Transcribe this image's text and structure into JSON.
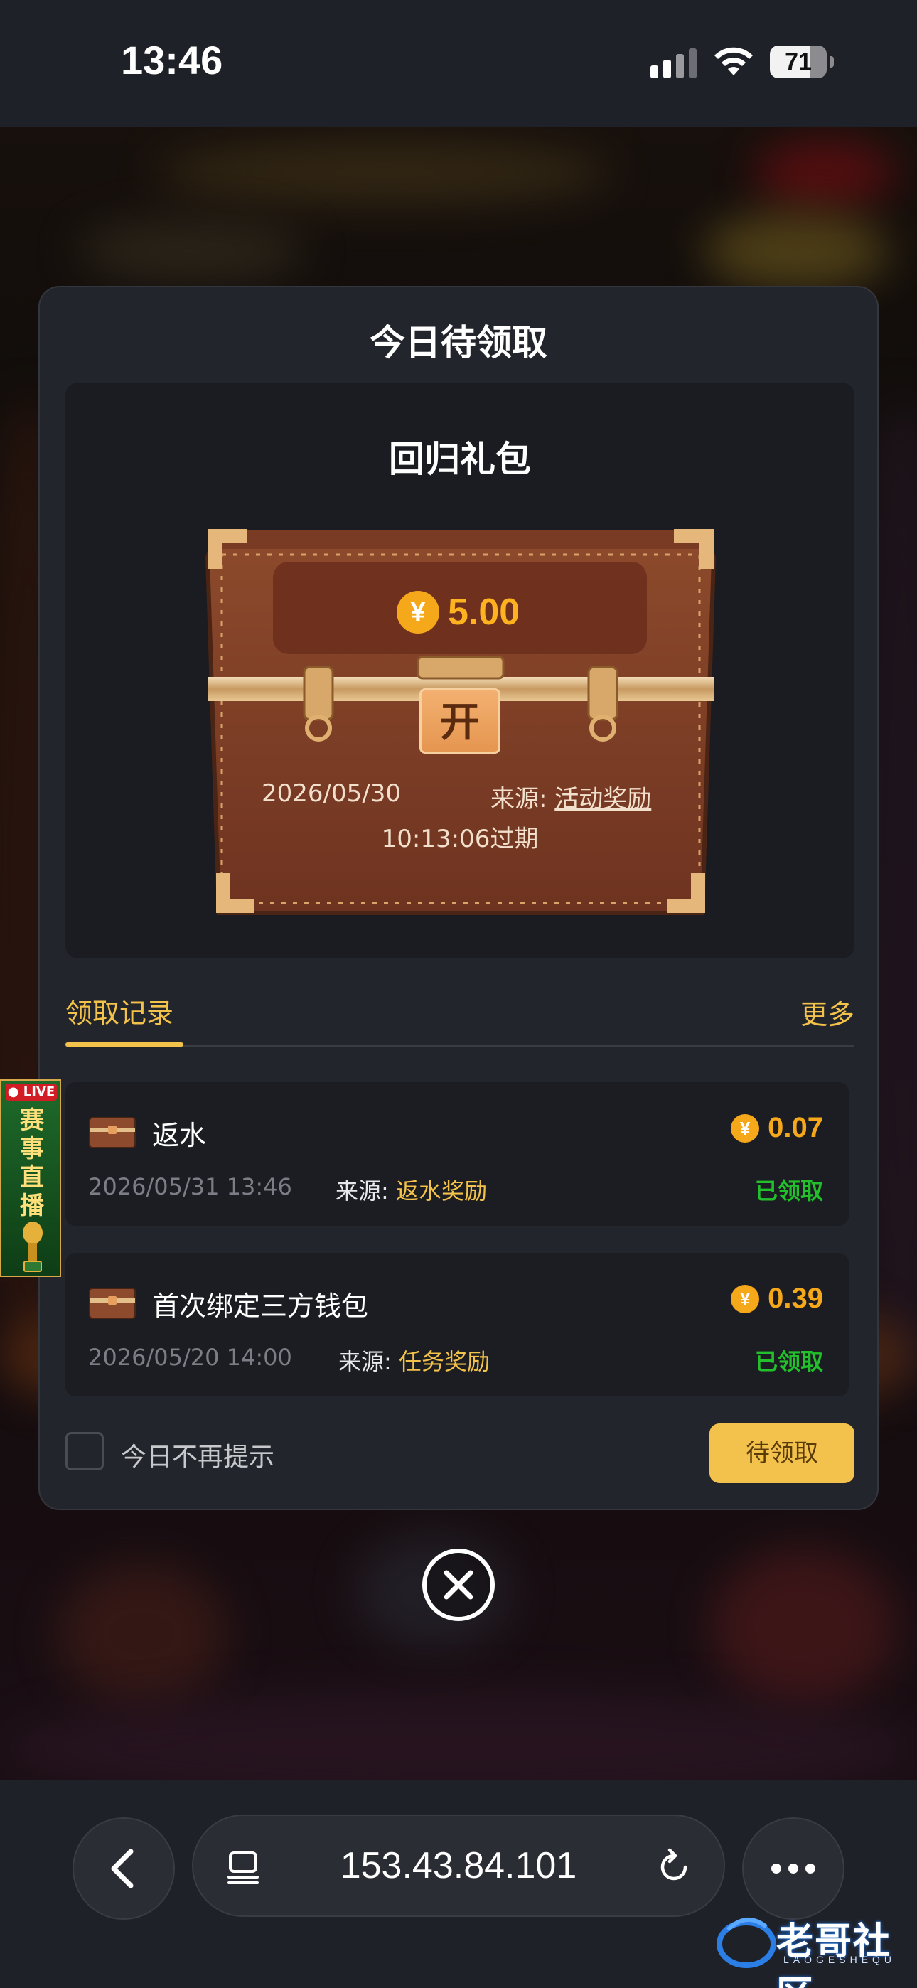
{
  "status_bar": {
    "time": "13:46",
    "battery_level": "71",
    "battery_fraction": 0.71,
    "icons": [
      "signal-icon",
      "wifi-icon",
      "battery-icon"
    ]
  },
  "dialog": {
    "title": "今日待领取",
    "chest": {
      "title": "回归礼包",
      "currency_symbol": "¥",
      "amount": "5.00",
      "open_label": "开",
      "date": "2026/05/30",
      "source_label": "来源:",
      "source_value": "活动奖励",
      "expire_text": "10:13:06过期"
    },
    "tabs": {
      "records_label": "领取记录",
      "more_label": "更多"
    },
    "records": [
      {
        "name": "返水",
        "amount": "0.07",
        "date": "2026/05/31 13:46",
        "source_label": "来源:",
        "source_value": "返水奖励",
        "status": "已领取"
      },
      {
        "name": "首次绑定三方钱包",
        "amount": "0.39",
        "date": "2026/05/20 14:00",
        "source_label": "来源:",
        "source_value": "任务奖励",
        "status": "已领取"
      }
    ],
    "footer": {
      "dont_show_label": "今日不再提示",
      "pending_button": "待领取"
    }
  },
  "live_banner": {
    "tag": "LIVE",
    "text": "赛事直播"
  },
  "browser": {
    "url": "153.43.84.101",
    "icons": [
      "back-icon",
      "tabs-icon",
      "reload-icon",
      "more-icon"
    ]
  },
  "watermark": {
    "text": "老哥社区",
    "sub": "LAOGESHEQU"
  },
  "colors": {
    "accent_gold": "#f3c24a",
    "coin_orange": "#f6a81b",
    "status_green": "#22c02b",
    "dialog_bg": "#23252c"
  }
}
